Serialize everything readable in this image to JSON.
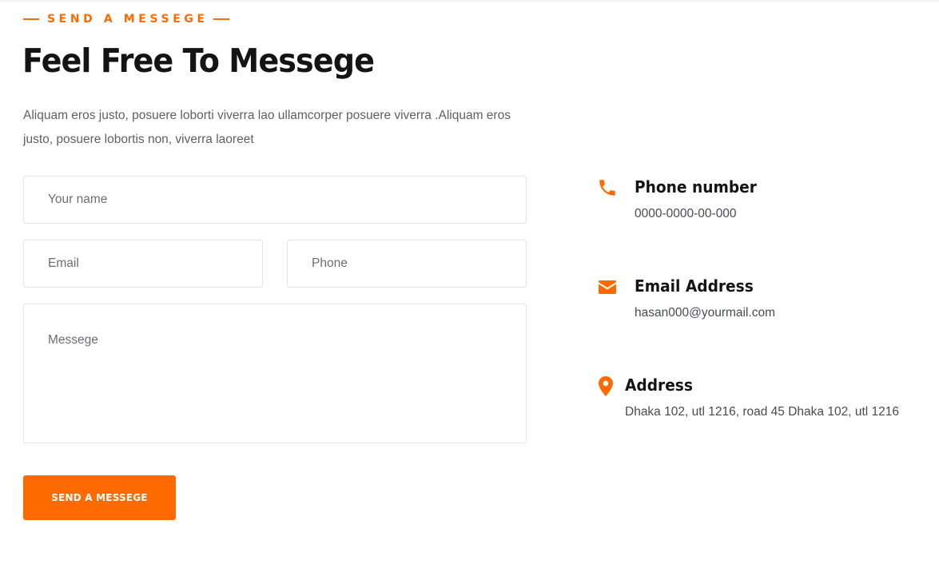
{
  "section": {
    "eyebrow": "SEND A MESSEGE",
    "title": "Feel Free To Messege",
    "description": "Aliquam eros justo, posuere loborti viverra lao ullamcorper posuere viverra .Aliquam eros justo, posuere lobortis non, viverra laoreet"
  },
  "form": {
    "name_placeholder": "Your name",
    "email_placeholder": "Email",
    "phone_placeholder": "Phone",
    "message_placeholder": "Messege",
    "submit_label": "SEND A MESSEGE"
  },
  "contact": {
    "phone": {
      "icon": "phone-icon",
      "label": "Phone number",
      "value": "0000-0000-00-000"
    },
    "email": {
      "icon": "envelope-icon",
      "label": "Email Address",
      "value": "hasan000@yourmail.com"
    },
    "address": {
      "icon": "map-pin-icon",
      "label": "Address",
      "value": "Dhaka 102, utl 1216, road 45 Dhaka 102, utl 1216"
    }
  },
  "colors": {
    "accent": "#ff6a00",
    "heading": "#141414",
    "body_text": "#5e5e6a",
    "border": "#e3e3e3"
  }
}
